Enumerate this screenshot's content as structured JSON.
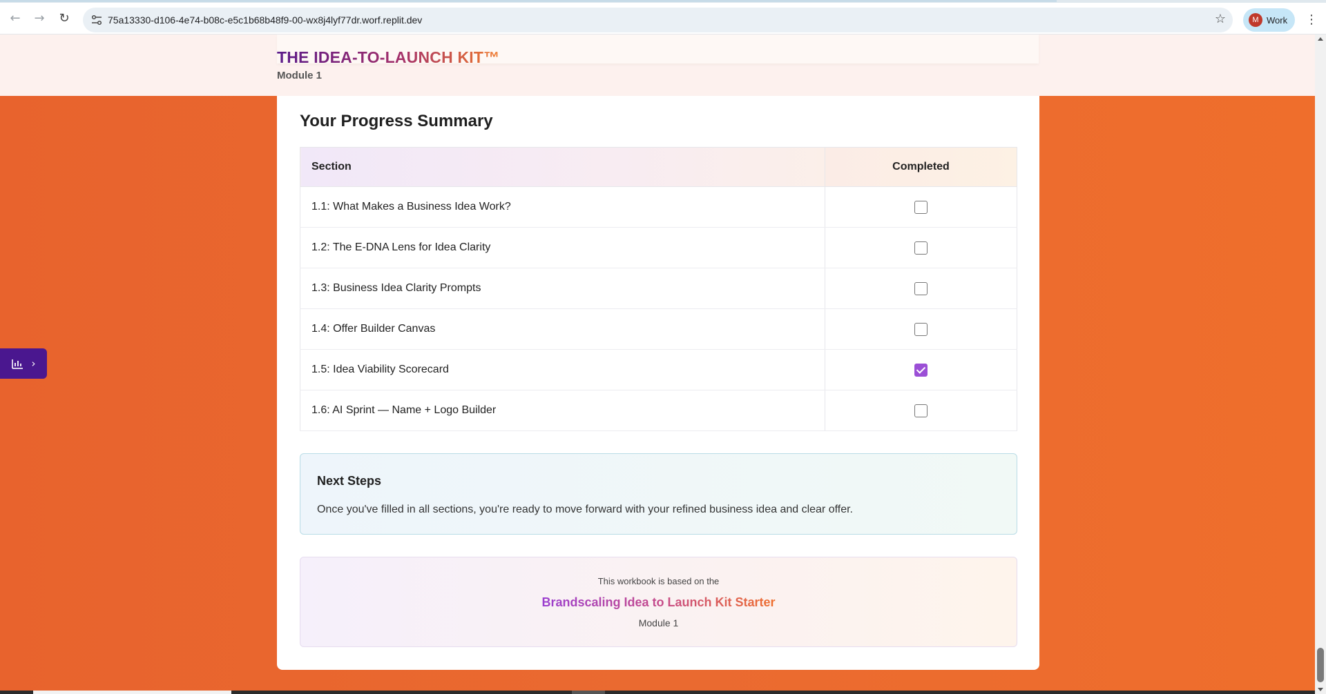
{
  "browser": {
    "url": "75a13330-d106-4e74-b08c-e5c1b68b48f9-00-wx8j4lyf77dr.worf.replit.dev",
    "profile_initial": "M",
    "profile_name": "Work",
    "back_icon": "arrow-left-icon",
    "forward_icon": "arrow-right-icon",
    "reload_icon": "reload-icon",
    "site_info_icon": "tune-icon",
    "bookmark_icon": "star-icon",
    "menu_icon": "kebab-icon"
  },
  "header": {
    "title": "THE IDEA-TO-LAUNCH KIT™",
    "subtitle": "Module 1"
  },
  "progress": {
    "title": "Your Progress Summary",
    "columns": [
      "Section",
      "Completed"
    ],
    "rows": [
      {
        "label": "1.1: What Makes a Business Idea Work?",
        "completed": false
      },
      {
        "label": "1.2: The E-DNA Lens for Idea Clarity",
        "completed": false
      },
      {
        "label": "1.3: Business Idea Clarity Prompts",
        "completed": false
      },
      {
        "label": "1.4: Offer Builder Canvas",
        "completed": false
      },
      {
        "label": "1.5: Idea Viability Scorecard",
        "completed": true
      },
      {
        "label": "1.6: AI Sprint — Name + Logo Builder",
        "completed": false
      }
    ]
  },
  "next_steps": {
    "heading": "Next Steps",
    "body": "Once you've filled in all sections, you're ready to move forward with your refined business idea and clear offer."
  },
  "credit": {
    "intro": "This workbook is based on the",
    "name": "Brandscaling Idea to Launch Kit Starter",
    "module": "Module 1"
  },
  "side_toggle": {
    "icon": "bar-chart-icon",
    "chevron": "chevron-right-icon"
  },
  "colors": {
    "page_background": "#ea6a30",
    "header_background": "#fdf1ee",
    "checkbox_checked": "#9b4fd6",
    "side_toggle": "#4a178f"
  }
}
